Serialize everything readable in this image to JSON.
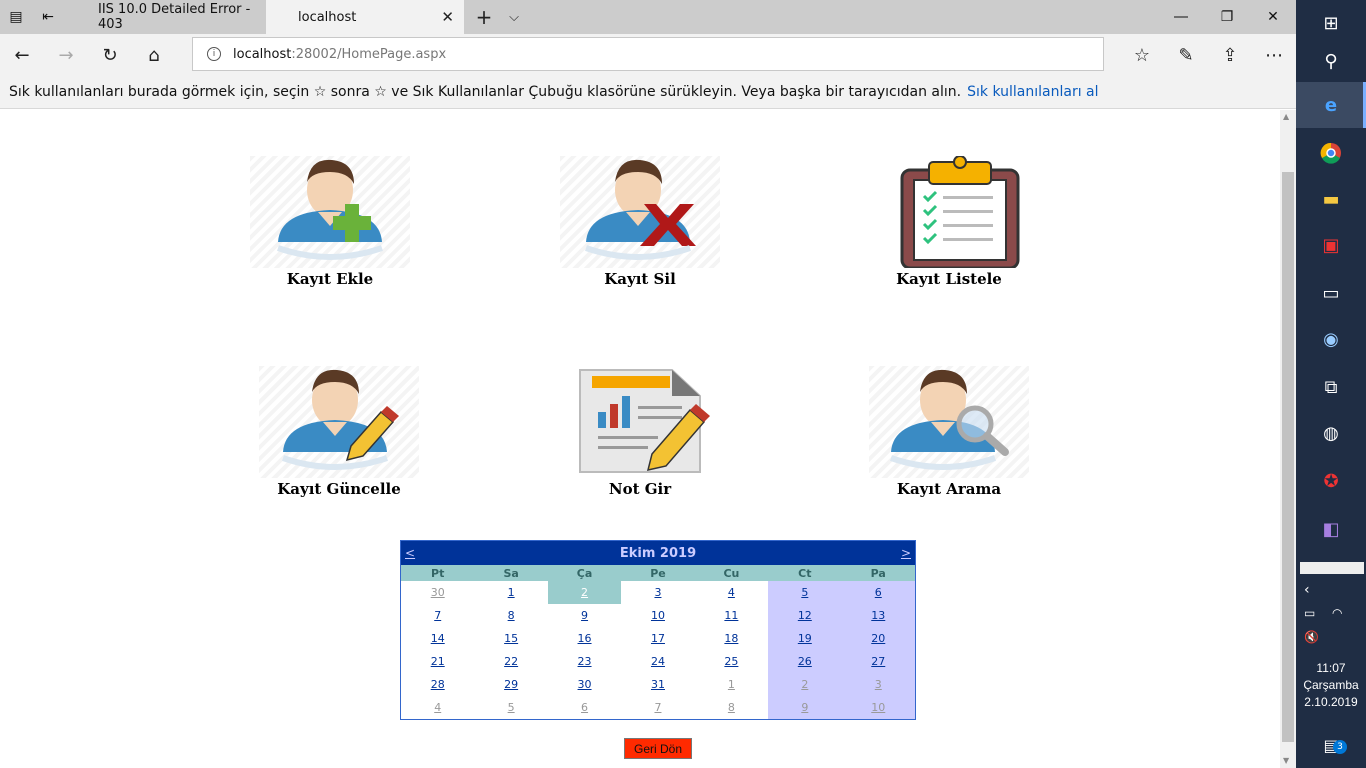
{
  "browser": {
    "tabs": [
      {
        "title": "IIS 10.0 Detailed Error - 403"
      },
      {
        "title": "localhost"
      }
    ],
    "address": {
      "host": "localhost",
      "rest": ":28002/HomePage.aspx"
    },
    "favbar": {
      "text": "Sık kullanılanları burada görmek için, seçin  ☆  sonra ☆ ve Sık Kullanılanlar Çubuğu klasörüne sürükleyin. Veya başka bir tarayıcıdan alın.",
      "link": "Sık kullanılanları al"
    }
  },
  "menu": [
    {
      "label": "Kayıt Ekle",
      "icon": "user-add-icon"
    },
    {
      "label": "Kayıt Sil",
      "icon": "user-delete-icon"
    },
    {
      "label": "Kayıt Listele",
      "icon": "clipboard-list-icon"
    },
    {
      "label": "Kayıt Güncelle",
      "icon": "user-edit-icon"
    },
    {
      "label": "Not Gir",
      "icon": "report-edit-icon"
    },
    {
      "label": "Kayıt Arama",
      "icon": "user-search-icon"
    }
  ],
  "calendar": {
    "prev": "<",
    "next": ">",
    "title": "Ekim 2019",
    "days": [
      "Pt",
      "Sa",
      "Ça",
      "Pe",
      "Cu",
      "Ct",
      "Pa"
    ],
    "weeks": [
      [
        "30",
        "1",
        "2",
        "3",
        "4",
        "5",
        "6"
      ],
      [
        "7",
        "8",
        "9",
        "10",
        "11",
        "12",
        "13"
      ],
      [
        "14",
        "15",
        "16",
        "17",
        "18",
        "19",
        "20"
      ],
      [
        "21",
        "22",
        "23",
        "24",
        "25",
        "26",
        "27"
      ],
      [
        "28",
        "29",
        "30",
        "31",
        "1",
        "2",
        "3"
      ],
      [
        "4",
        "5",
        "6",
        "7",
        "8",
        "9",
        "10"
      ]
    ],
    "today": "2"
  },
  "back_button": "Geri Dön",
  "taskbar": {
    "time": "11:07",
    "day": "Çarşamba",
    "date": "2.10.2019",
    "notifications": "3"
  }
}
